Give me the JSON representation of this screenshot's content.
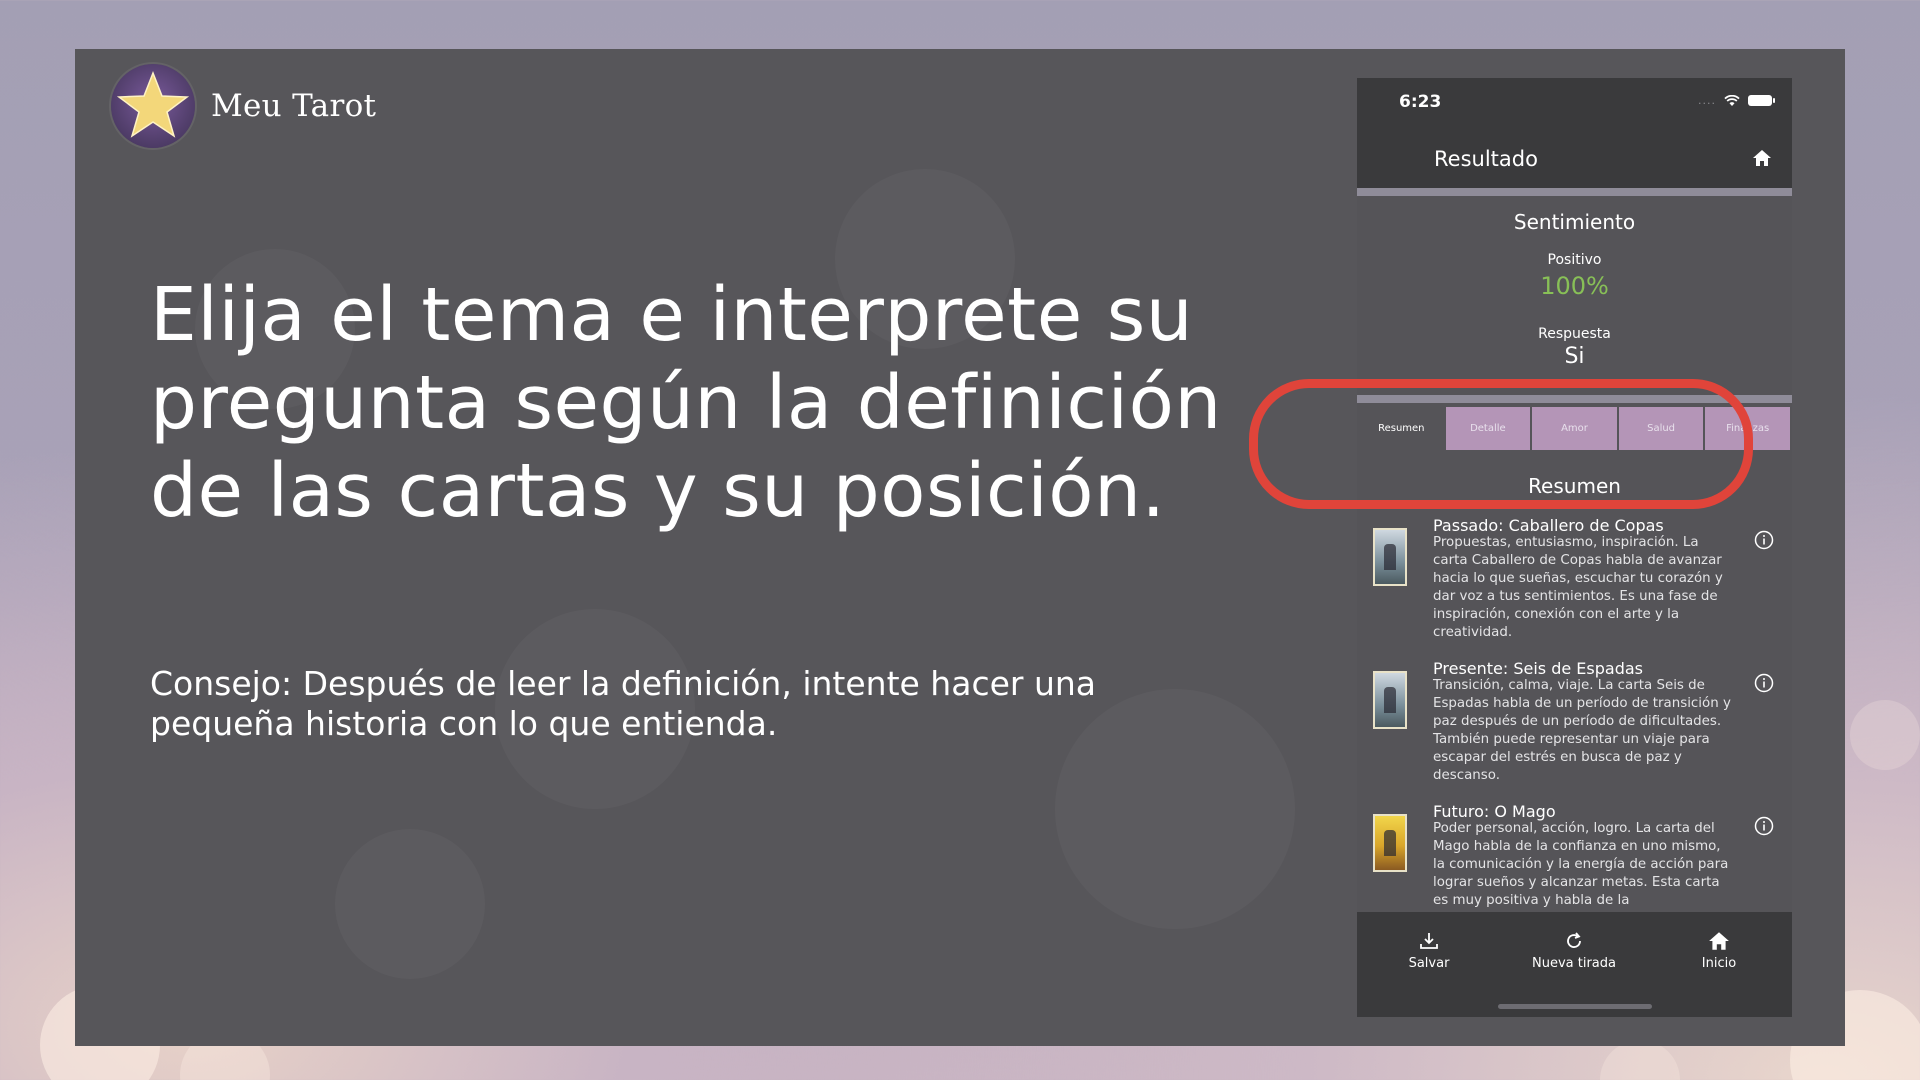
{
  "brand": {
    "name": "Meu Tarot"
  },
  "headline": "Elija el tema e interprete su pregunta según la definición de las cartas y su posición.",
  "tip": "Consejo: Después de leer la definición, intente hacer una pequeña historia con lo que entienda.",
  "phone": {
    "status": {
      "time": "6:23",
      "signal": "...."
    },
    "nav": {
      "title": "Resultado",
      "home_icon": "home-icon"
    },
    "sentiment": {
      "title": "Sentimiento",
      "positive_label": "Positivo",
      "positive_value": "100%",
      "answer_label": "Respuesta",
      "answer_value": "Si"
    },
    "tabs": [
      {
        "label": "Resumen"
      },
      {
        "label": "Detalle"
      },
      {
        "label": "Amor"
      },
      {
        "label": "Salud"
      },
      {
        "label": "Finanzas"
      }
    ],
    "section_heading": "Resumen",
    "cards": [
      {
        "title": "Passado:   Caballero de Copas",
        "text": "Propuestas, entusiasmo, inspiración. La carta Caballero de Copas habla de avanzar hacia lo que sueñas, escuchar tu corazón y dar voz a tus sentimientos. Es una fase de inspiración, conexión con el arte y la creatividad."
      },
      {
        "title": "Presente:   Seis de Espadas",
        "text": "Transición, calma, viaje. La carta Seis de Espadas habla de un período de transición y paz después de un período de dificultades. También puede representar un viaje para escapar del estrés en busca de paz y descanso."
      },
      {
        "title": "Futuro:   O Mago",
        "text": "Poder personal, acción, logro. La carta del Mago habla de la confianza en uno mismo, la comunicación y la energía de acción para lograr sueños y alcanzar metas. Esta carta es muy positiva y habla de la"
      }
    ],
    "tabbar": {
      "save": "Salvar",
      "new": "Nueva tirada",
      "home": "Inicio"
    }
  },
  "colors": {
    "positive": "#88c057",
    "highlight": "#e0443a",
    "tab_bg": "#b495b7"
  }
}
